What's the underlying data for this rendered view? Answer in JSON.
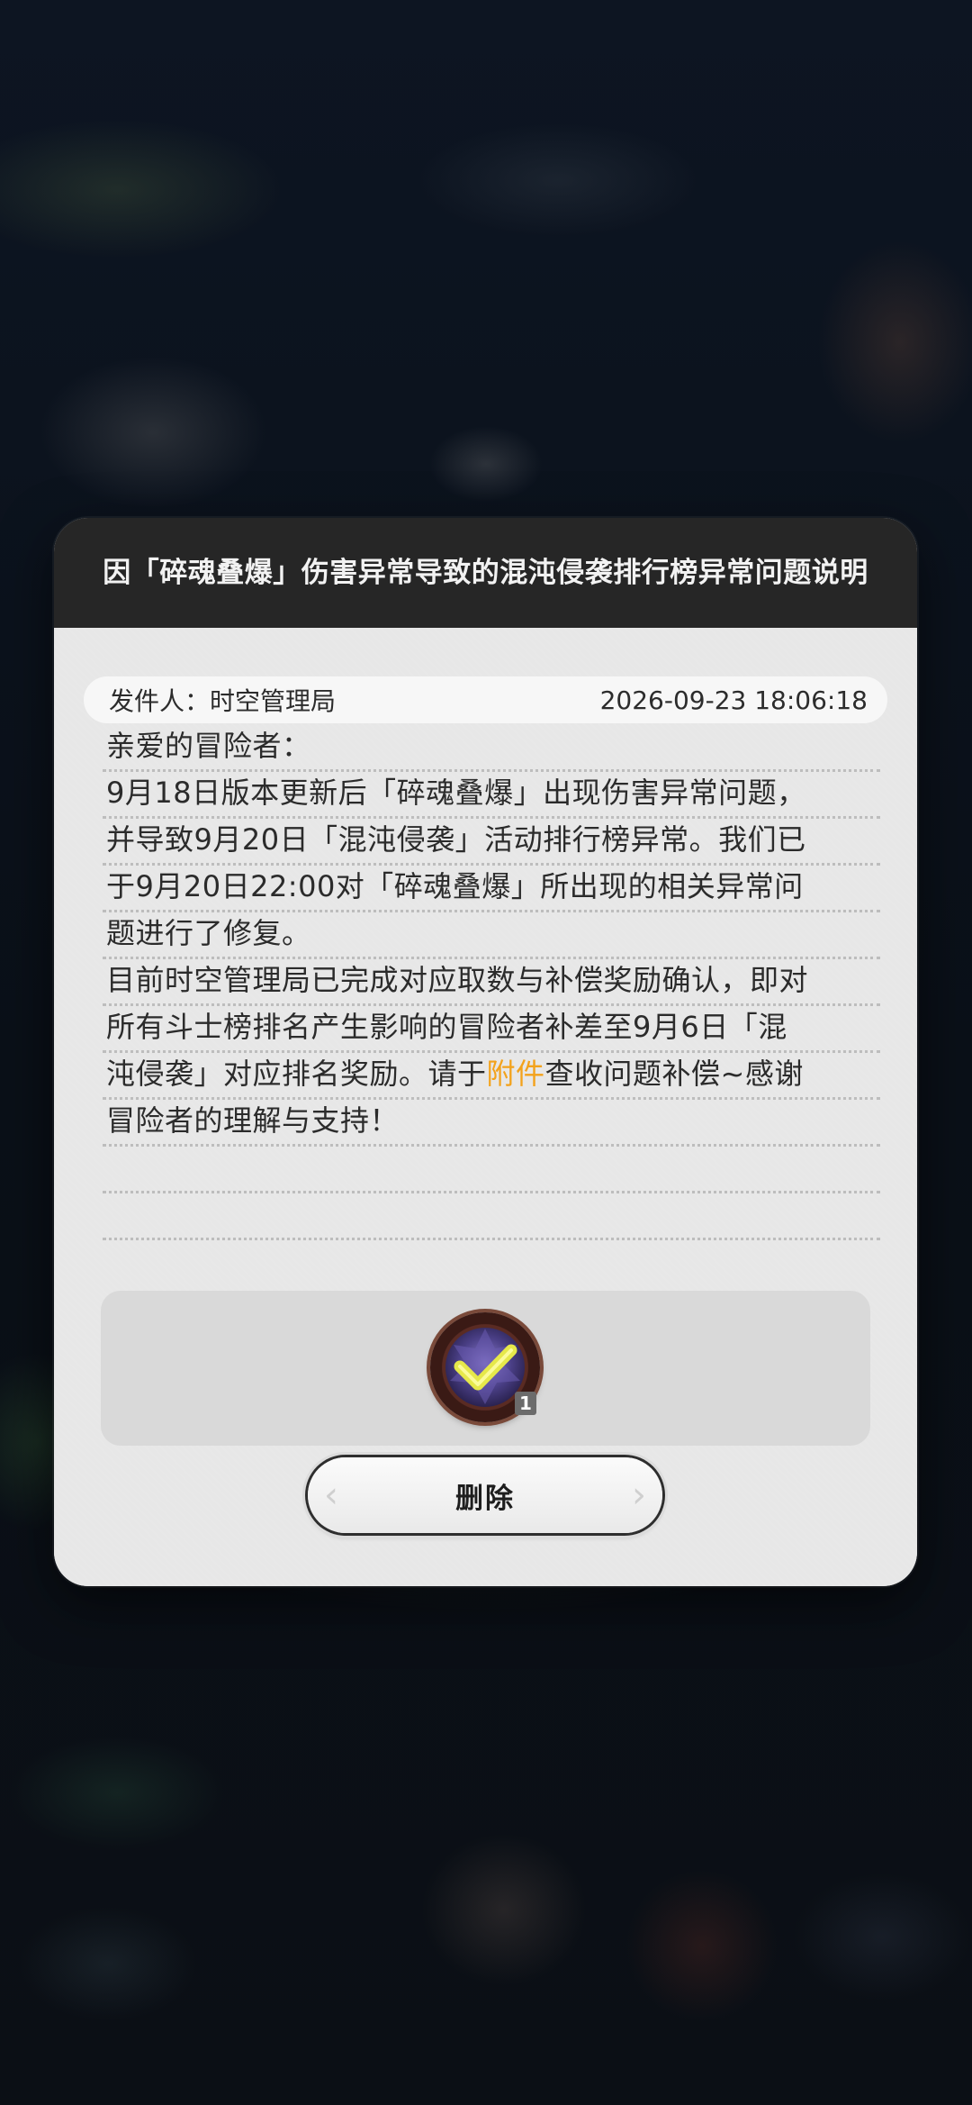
{
  "mail": {
    "title": "因「碎魂叠爆」伤害异常导致的混沌侵袭排行榜异常问题说明",
    "sender_label": "发件人：",
    "sender_name": "时空管理局",
    "timestamp": "2026-09-23 18:06:18",
    "lines": [
      {
        "text": "亲爱的冒险者："
      },
      {
        "text": "9月18日版本更新后「碎魂叠爆」出现伤害异常问题，"
      },
      {
        "text": "并导致9月20日「混沌侵袭」活动排行榜异常。我们已"
      },
      {
        "text": "于9月20日22:00对「碎魂叠爆」所出现的相关异常问"
      },
      {
        "text": "题进行了修复。"
      },
      {
        "text": "目前时空管理局已完成对应取数与补偿奖励确认，即对"
      },
      {
        "text": "所有斗士榜排名产生影响的冒险者补差至9月6日「混"
      },
      {
        "before": "沌侵袭」对应排名奖励。请于",
        "highlight": "附件",
        "after": "查收问题补偿~感谢"
      },
      {
        "text": "冒险者的理解与支持！"
      },
      {
        "text": ""
      },
      {
        "text": ""
      }
    ],
    "attachment": {
      "icon": "check-badge-icon",
      "count": "1"
    },
    "delete_label": "删除"
  },
  "colors": {
    "highlight": "#f3a21b",
    "header_bg": "#262626",
    "body_bg": "#e7e7e7"
  }
}
